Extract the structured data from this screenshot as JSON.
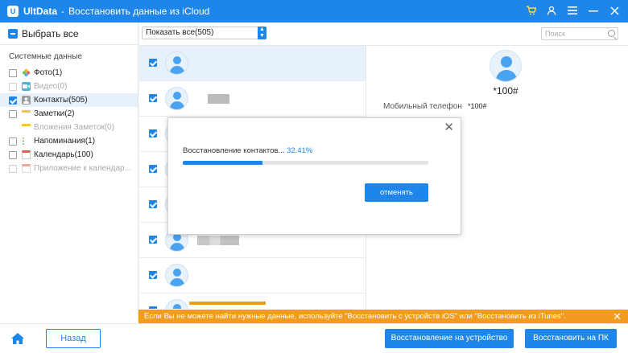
{
  "titlebar": {
    "logo_letter": "U",
    "app_name": "UltData",
    "separator": "-",
    "subtitle": "Восстановить данные из iCloud",
    "icons": [
      "cart-icon",
      "account-icon",
      "menu-icon",
      "minimize-icon",
      "close-icon"
    ]
  },
  "sidebar": {
    "select_all": "Выбрать все",
    "section_title": "Системные данные",
    "categories": [
      {
        "label": "Фото(1)",
        "icon": "photos-icon",
        "checked": false,
        "disabled": false
      },
      {
        "label": "Видео(0)",
        "icon": "video-icon",
        "checked": false,
        "disabled": true
      },
      {
        "label": "Контакты(505)",
        "icon": "contacts-icon",
        "checked": true,
        "disabled": false
      },
      {
        "label": "Заметки(2)",
        "icon": "notes-icon",
        "checked": false,
        "disabled": false
      },
      {
        "label": "Вложения Заметок(0)",
        "icon": "notes-attachment-icon",
        "checked": false,
        "disabled": true
      },
      {
        "label": "Напоминания(1)",
        "icon": "reminders-icon",
        "checked": false,
        "disabled": false
      },
      {
        "label": "Календарь(100)",
        "icon": "calendar-icon",
        "checked": false,
        "disabled": false
      },
      {
        "label": "Приложение к календар...",
        "icon": "calendar-attachment-icon",
        "checked": false,
        "disabled": true
      }
    ]
  },
  "list": {
    "filter_value": "Показать все(505)",
    "search_placeholder": "Поиск",
    "row_count": 8
  },
  "detail": {
    "name": "*100#",
    "field_label": "Мобильный телефон",
    "field_value": "*100#"
  },
  "modal": {
    "text": "Восстановление контактов...",
    "percent_label": "32.41%",
    "progress": 0.3241,
    "cancel_label": "отменять"
  },
  "banner": {
    "text": "Если Вы не можете найти нужные данные, используйте \"Восстановить с устройств iOS\" или \"Восстановить из iTunes\"."
  },
  "bottom": {
    "back_label": "Назад",
    "restore_device_label": "Восстановление на устройство",
    "restore_pc_label": "Восстановить на ПК"
  },
  "colors": {
    "accent": "#1e86e8",
    "banner": "#f19b1f"
  }
}
